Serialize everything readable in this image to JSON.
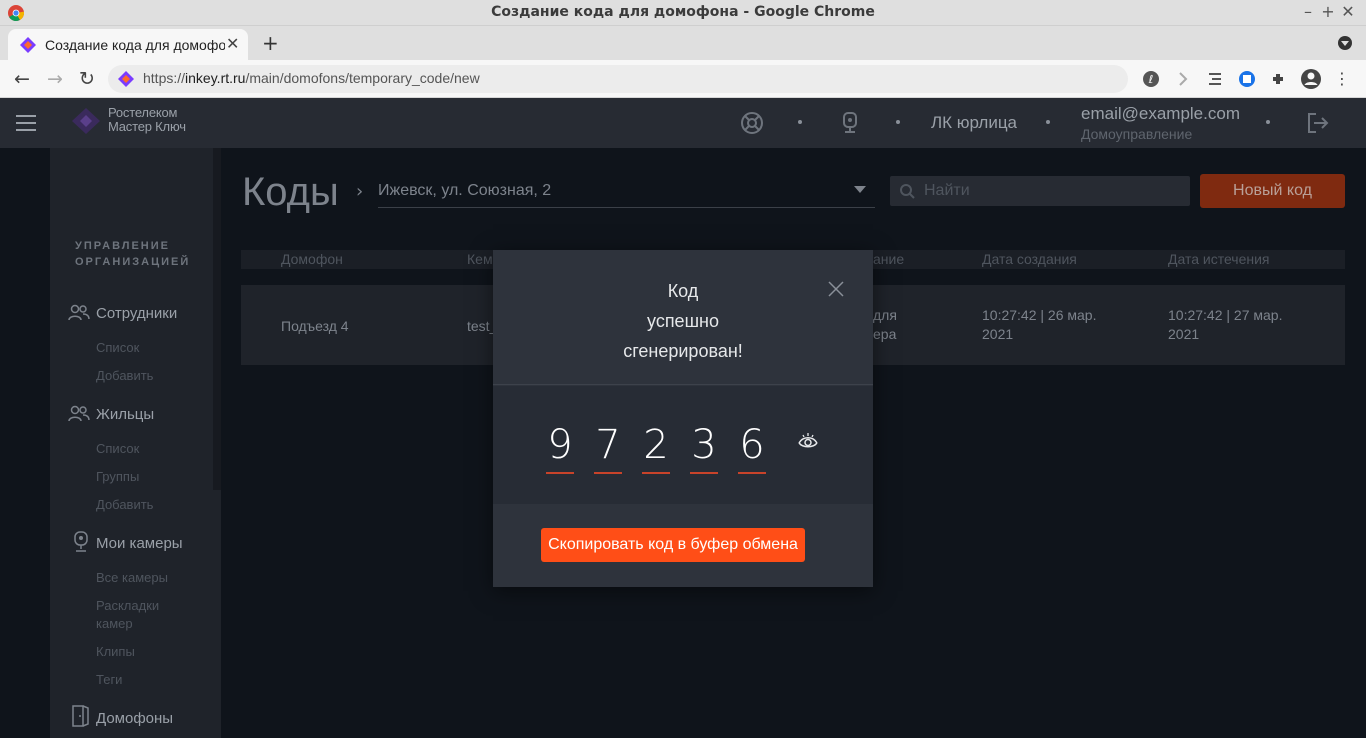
{
  "browser": {
    "window_title": "Создание кода для домофона - Google Chrome",
    "tab_title": "Создание кода для домофона",
    "url_scheme": "https://",
    "url_host": "inkey.rt.ru",
    "url_path": "/main/domofons/temporary_code/new"
  },
  "header": {
    "logo_line1": "Ростелеком",
    "logo_line2": "Мастер Ключ",
    "account_type": "ЛК юрлица",
    "user_email": "email@example.com",
    "user_role": "Домоуправление"
  },
  "sidebar": {
    "section_title_1": "УПРАВЛЕНИЕ",
    "section_title_2": "ОРГАНИЗАЦИЕЙ",
    "groups": [
      {
        "label": "Сотрудники",
        "items": [
          "Список",
          "Добавить"
        ]
      },
      {
        "label": "Жильцы",
        "items": [
          "Список",
          "Группы",
          "Добавить"
        ]
      },
      {
        "label": "Мои камеры",
        "items": [
          "Все камеры",
          "Раскладки камер",
          "Клипы",
          "Теги"
        ]
      },
      {
        "label": "Домофоны",
        "items": []
      }
    ]
  },
  "main": {
    "page_title": "Коды",
    "address": "Ижевск, ул. Союзная, 2",
    "search_placeholder": "Найти",
    "new_code_label": "Новый код",
    "columns": [
      "Домофон",
      "Кем",
      "ание",
      "Дата создания",
      "Дата истечения"
    ],
    "rows": [
      {
        "intercom": "Подъезд 4",
        "creator": "test_",
        "description_line1": "для",
        "description_line2": "ера",
        "created_line1": "10:27:42 | 26 мар.",
        "created_line2": "2021",
        "expires_line1": "10:27:42 | 27 мар.",
        "expires_line2": "2021"
      }
    ]
  },
  "modal": {
    "title_line1": "Код",
    "title_line2": "успешно",
    "title_line3": "сгенерирован!",
    "digits": [
      "9",
      "7",
      "2",
      "3",
      "6"
    ],
    "copy_label": "Скопировать код в буфер обмена"
  },
  "colors": {
    "accent": "#ff4e17",
    "header_bg": "#272b33",
    "modal_bg": "#2e333c"
  }
}
